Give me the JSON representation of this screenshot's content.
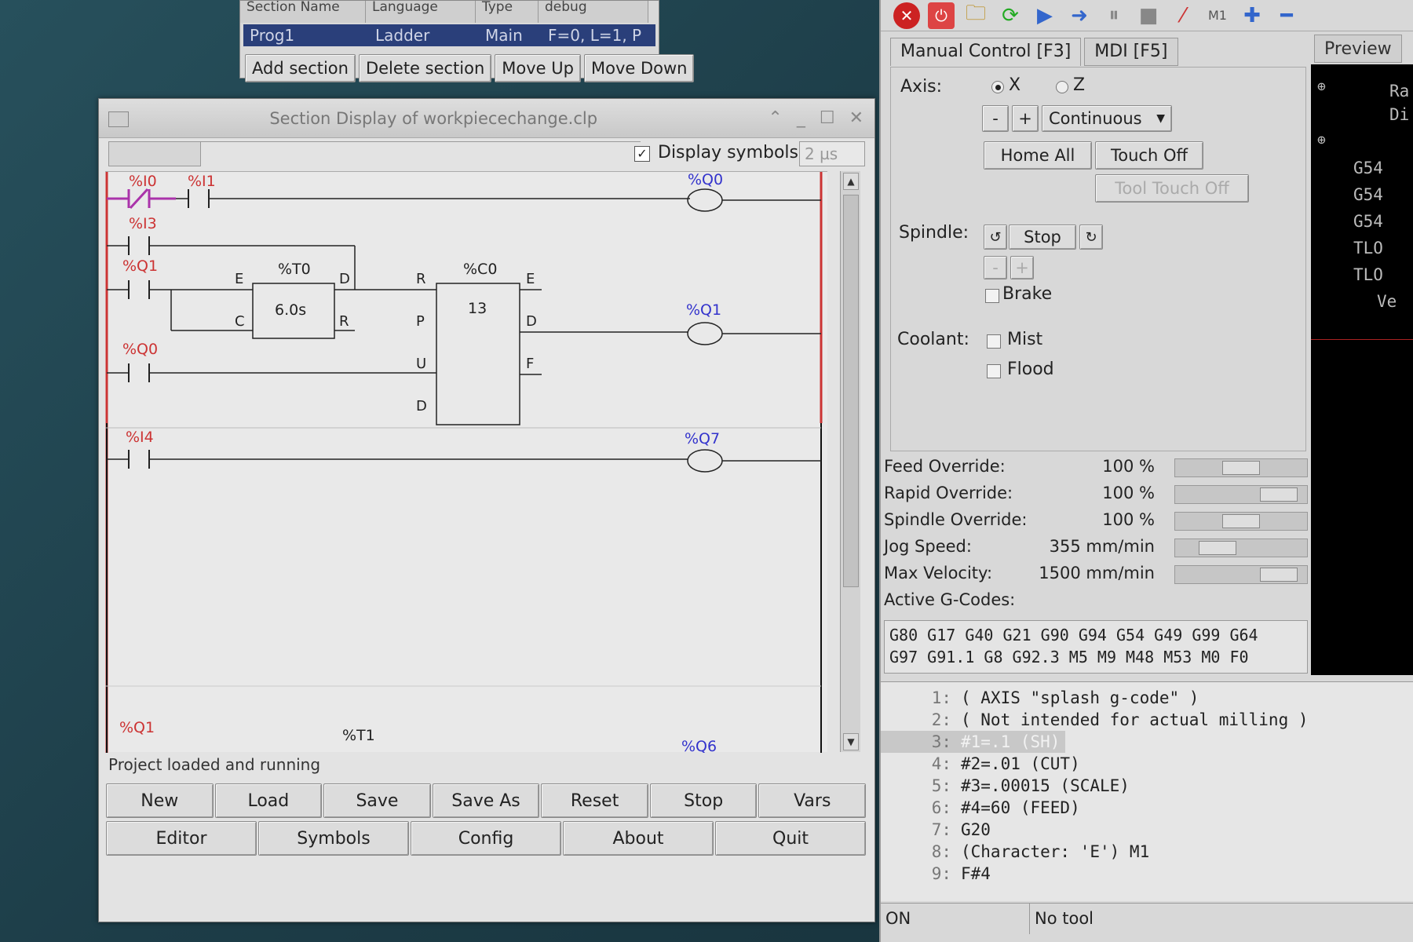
{
  "section_manager": {
    "headers": [
      "Section Name",
      "Language",
      "Type",
      "debug"
    ],
    "row": [
      "Prog1",
      "Ladder",
      "Main",
      "F=0, L=1, P"
    ],
    "buttons": [
      "Add section",
      "Delete section",
      "Move Up",
      "Move Down"
    ]
  },
  "section_window": {
    "title": "Section Display of workpiecechange.clp",
    "display_symbols_label": "Display symbols",
    "display_symbols_checked": "✓",
    "timing": "2 µs",
    "status": "Project loaded and running",
    "buttons_row1": [
      "New",
      "Load",
      "Save",
      "Save As",
      "Reset",
      "Stop",
      "Vars"
    ],
    "buttons_row2": [
      "Editor",
      "Symbols",
      "Config",
      "About",
      "Quit"
    ]
  },
  "ladder": {
    "rung1": {
      "contacts": [
        "%I0",
        "%I1"
      ],
      "coil": "%Q0"
    },
    "rung2": {
      "contacts": [
        "%I3",
        "%Q1",
        "%Q0"
      ]
    },
    "timer": {
      "name": "%T0",
      "preset": "6.0s",
      "pins": [
        "E",
        "C",
        "D",
        "R"
      ]
    },
    "counter": {
      "name": "%C0",
      "preset": "13",
      "pins_in": [
        "R",
        "P",
        "U",
        "D"
      ],
      "pins_out": [
        "E",
        "D",
        "F"
      ]
    },
    "coil2": "%Q1",
    "rung3": {
      "contact": "%I4",
      "coil": "%Q7"
    },
    "rung4": {
      "contact": "%Q1",
      "block": "%T1",
      "coil": "%Q6"
    }
  },
  "cnc": {
    "tabs": [
      "Manual Control [F3]",
      "MDI [F5]"
    ],
    "preview_tab": "Preview",
    "axis_label": "Axis:",
    "axis_options": [
      "X",
      "Z"
    ],
    "jog_minus": "-",
    "jog_plus": "+",
    "jog_mode": "Continuous",
    "home_all": "Home All",
    "touch_off": "Touch Off",
    "tool_touch_off": "Tool Touch Off",
    "spindle_label": "Spindle:",
    "spindle_stop": "Stop",
    "brake_label": "Brake",
    "coolant_label": "Coolant:",
    "mist_label": "Mist",
    "flood_label": "Flood",
    "overrides": [
      {
        "label": "Feed Override:",
        "value": "100 %",
        "level": 0.5
      },
      {
        "label": "Rapid Override:",
        "value": "100 %",
        "level": 0.9
      },
      {
        "label": "Spindle Override:",
        "value": "100 %",
        "level": 0.5
      },
      {
        "label": "Jog Speed:",
        "value": "355 mm/min",
        "level": 0.25
      },
      {
        "label": "Max Velocity:",
        "value": "1500 mm/min",
        "level": 0.9
      }
    ],
    "active_gcodes_label": "Active G-Codes:",
    "gcodes": [
      "G80 G17 G40 G21 G90 G94 G54 G49 G99 G64",
      "G97 G91.1 G8 G92.3 M5 M9 M48 M53 M0 F0"
    ],
    "preview_text": [
      "Ra",
      "Di",
      "G54",
      "G54",
      "G54",
      "TLO",
      "TLO",
      "Ve"
    ],
    "program": [
      {
        "n": "1:",
        "t": "( AXIS \"splash g-code\" )"
      },
      {
        "n": "2:",
        "t": "( Not intended for actual milling )"
      },
      {
        "n": "3:",
        "t": "#1=.1 (SH)"
      },
      {
        "n": "4:",
        "t": "#2=.01 (CUT)"
      },
      {
        "n": "5:",
        "t": "#3=.00015 (SCALE)"
      },
      {
        "n": "6:",
        "t": "#4=60 (FEED)"
      },
      {
        "n": "7:",
        "t": "G20"
      },
      {
        "n": "8:",
        "t": "(Character: 'E') M1"
      },
      {
        "n": "9:",
        "t": "F#4"
      }
    ],
    "status_state": "ON",
    "status_tool": "No tool"
  }
}
